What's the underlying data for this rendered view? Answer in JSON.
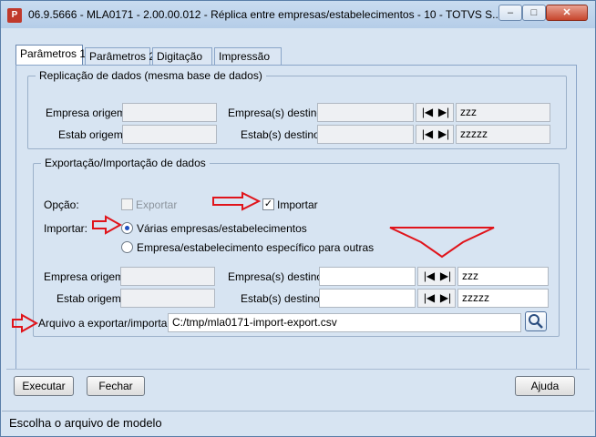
{
  "window": {
    "title": "06.9.5666 - MLA0171 - 2.00.00.012 - Réplica entre empresas/estabelecimentos - 10 - TOTVS S...",
    "app_icon": "P",
    "controls": {
      "minimize": "–",
      "maximize": "□",
      "close": "✕"
    }
  },
  "tabs": [
    {
      "label": "Parâmetros 1",
      "active": true
    },
    {
      "label": "Parâmetros 2",
      "active": false
    },
    {
      "label": "Digitação",
      "active": false
    },
    {
      "label": "Impressão",
      "active": false
    }
  ],
  "replication_group": {
    "legend": "Replicação de dados (mesma base de dados)",
    "empresa_origem_label": "Empresa origem:",
    "empresa_origem_value": "",
    "estab_origem_label": "Estab origem:",
    "estab_origem_value": "",
    "empresa_destino_label": "Empresa(s) destino:",
    "empresa_destino_value": "",
    "empresa_destino_code": "zzz",
    "estab_destino_label": "Estab(s) destino:",
    "estab_destino_value": "",
    "estab_destino_code": "zzzzz"
  },
  "export_group": {
    "legend": "Exportação/Importação de dados",
    "opcao_label": "Opção:",
    "exportar_label": "Exportar",
    "exportar_checked": false,
    "importar_label": "Importar",
    "importar_checked": true,
    "importar_mode_label": "Importar:",
    "radio_options": [
      {
        "label": "Várias empresas/estabelecimentos",
        "selected": true
      },
      {
        "label": "Empresa/estabelecimento específico para outras",
        "selected": false
      }
    ],
    "empresa_origem_label": "Empresa origem:",
    "empresa_origem_value": "",
    "estab_origem_label": "Estab origem:",
    "estab_origem_value": "",
    "empresa_destino_label": "Empresa(s) destino:",
    "empresa_destino_value": "",
    "empresa_destino_code": "zzz",
    "estab_destino_label": "Estab(s) destino:",
    "estab_destino_value": "",
    "estab_destino_code": "zzzzz",
    "arquivo_label": "Arquivo a exportar/importar:",
    "arquivo_value": "C:/tmp/mla0171-import-export.csv"
  },
  "nav": {
    "first": "|◀",
    "last": "▶|"
  },
  "buttons": {
    "executar": "Executar",
    "fechar": "Fechar",
    "ajuda": "Ajuda"
  },
  "status": "Escolha o arquivo de modelo",
  "colors": {
    "annotation_arrow": "#e0141b",
    "window_bg": "#d7e4f2"
  }
}
